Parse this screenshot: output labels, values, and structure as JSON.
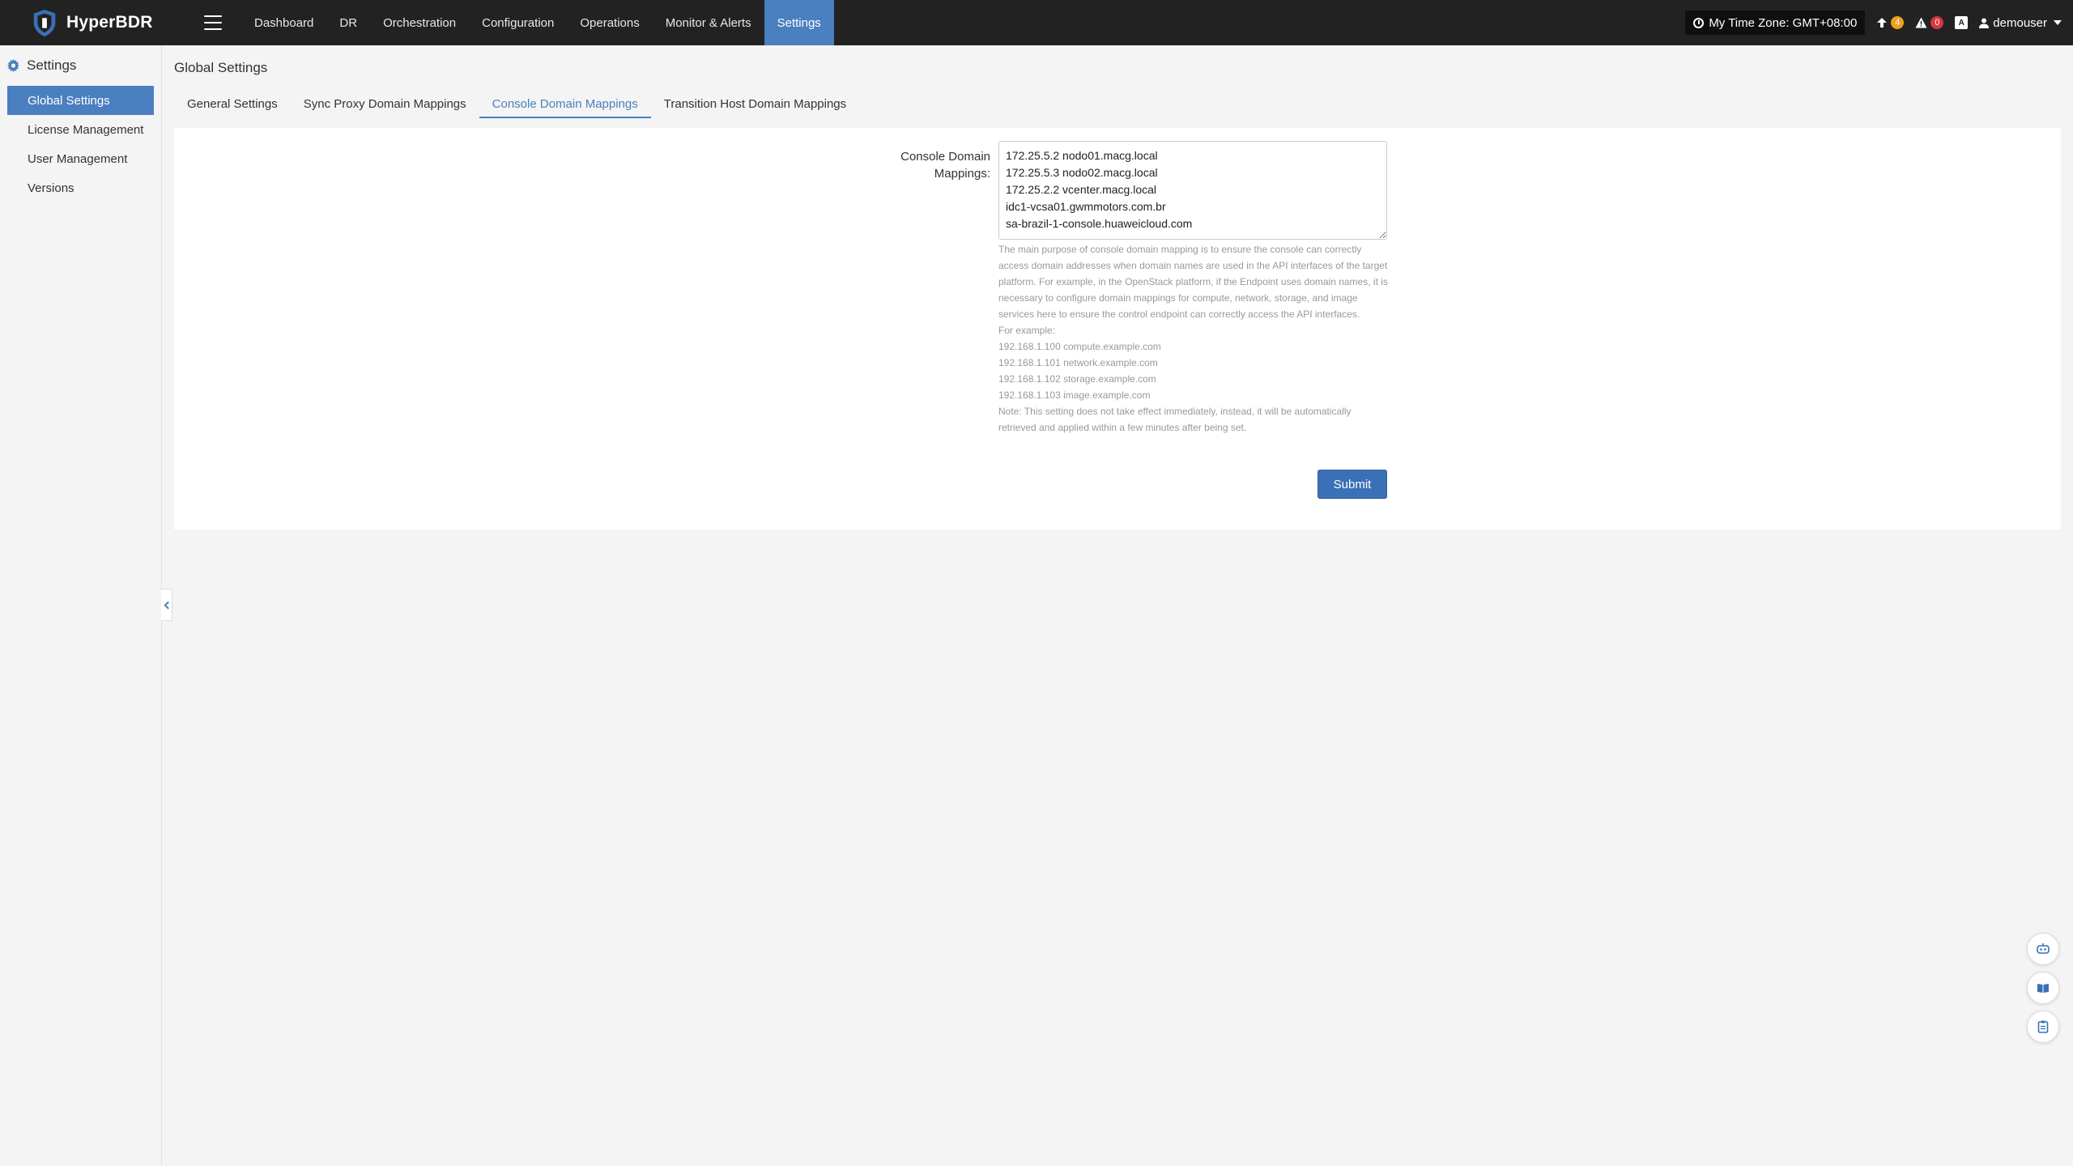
{
  "app": {
    "name": "HyperBDR"
  },
  "nav": {
    "items": [
      {
        "label": "Dashboard",
        "active": false
      },
      {
        "label": "DR",
        "active": false
      },
      {
        "label": "Orchestration",
        "active": false
      },
      {
        "label": "Configuration",
        "active": false
      },
      {
        "label": "Operations",
        "active": false
      },
      {
        "label": "Monitor & Alerts",
        "active": false
      },
      {
        "label": "Settings",
        "active": true
      }
    ]
  },
  "header": {
    "timezone": "My Time Zone: GMT+08:00",
    "upgrade_count": "4",
    "alert_count": "0",
    "lang_icon": "A",
    "username": "demouser"
  },
  "sidebar": {
    "title": "Settings",
    "items": [
      {
        "label": "Global Settings",
        "active": true
      },
      {
        "label": "License Management",
        "active": false
      },
      {
        "label": "User Management",
        "active": false
      },
      {
        "label": "Versions",
        "active": false
      }
    ]
  },
  "main": {
    "page_title": "Global Settings",
    "tabs": [
      {
        "label": "General Settings",
        "active": false
      },
      {
        "label": "Sync Proxy Domain Mappings",
        "active": false
      },
      {
        "label": "Console Domain Mappings",
        "active": true
      },
      {
        "label": "Transition Host Domain Mappings",
        "active": false
      }
    ],
    "form": {
      "label": "Console Domain Mappings:",
      "value": "172.25.5.2 nodo01.macg.local\n172.25.5.3 nodo02.macg.local\n172.25.2.2 vcenter.macg.local\nidc1-vcsa01.gwmmotors.com.br\nsa-brazil-1-console.huaweicloud.com",
      "help": {
        "description": "The main purpose of console domain mapping is to ensure the console can correctly access domain addresses when domain names are used in the API interfaces of the target platform. For example, in the OpenStack platform, if the Endpoint uses domain names, it is necessary to configure domain mappings for compute, network, storage, and image services here to ensure the control endpoint can correctly access the API interfaces.",
        "example_title": "For example:",
        "examples": [
          "192.168.1.100 compute.example.com",
          "192.168.1.101 network.example.com",
          "192.168.1.102 storage.example.com",
          "192.168.1.103 image.example.com"
        ],
        "note": "Note: This setting does not take effect immediately, instead, it will be automatically retrieved and applied within a few minutes after being set."
      },
      "submit_label": "Submit"
    }
  },
  "colors": {
    "accent": "#4a7fc0",
    "topbar": "#222222",
    "badge_orange": "#f0a020",
    "badge_red": "#d9363e"
  }
}
